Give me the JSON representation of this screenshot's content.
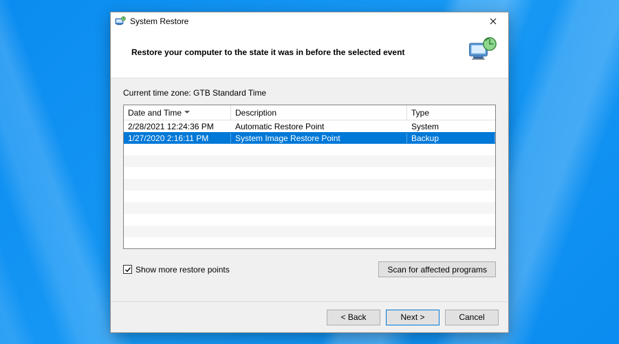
{
  "window": {
    "title": "System Restore"
  },
  "header": {
    "heading": "Restore your computer to the state it was in before the selected event"
  },
  "content": {
    "timezone_label": "Current time zone: GTB Standard Time",
    "columns": {
      "datetime": "Date and Time",
      "description": "Description",
      "type": "Type"
    },
    "rows": [
      {
        "datetime": "2/28/2021 12:24:36 PM",
        "description": "Automatic Restore Point",
        "type": "System",
        "selected": false
      },
      {
        "datetime": "1/27/2020 2:16:11 PM",
        "description": "System Image Restore Point",
        "type": "Backup",
        "selected": true
      }
    ],
    "show_more_label": "Show more restore points",
    "show_more_checked": true,
    "scan_button": "Scan for affected programs"
  },
  "footer": {
    "back": "< Back",
    "next": "Next >",
    "cancel": "Cancel"
  },
  "icons": {
    "app": "system-restore-icon",
    "header": "system-restore-large-icon",
    "close": "close-icon",
    "sort": "sort-descending-icon",
    "check": "checkmark-icon"
  }
}
